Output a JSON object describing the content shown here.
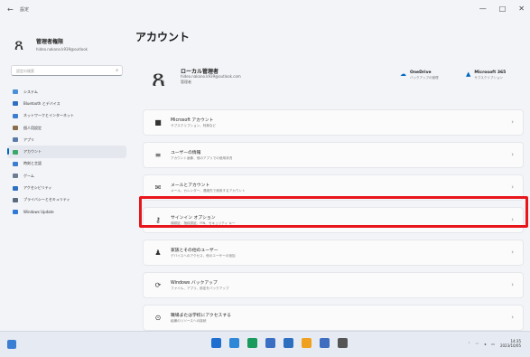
{
  "window": {
    "back_glyph": "←",
    "app_title": "設定",
    "controls": [
      "—",
      "□",
      "✕"
    ]
  },
  "sidebar": {
    "profile": {
      "name": "管理者権限",
      "email": "hideo.nakano.k939@outlook"
    },
    "search_placeholder": "設定の検索",
    "items": [
      {
        "label": "システム",
        "color": "#4a8fd8",
        "active": false
      },
      {
        "label": "Bluetooth とデバイス",
        "color": "#2f6fc0",
        "active": false
      },
      {
        "label": "ネットワークとインターネット",
        "color": "#3c7dd0",
        "active": false
      },
      {
        "label": "個人用設定",
        "color": "#8a6d4a",
        "active": false
      },
      {
        "label": "アプリ",
        "color": "#5a7aa8",
        "active": false
      },
      {
        "label": "アカウント",
        "color": "#39a86a",
        "active": true
      },
      {
        "label": "時刻と言語",
        "color": "#3c7dd0",
        "active": false
      },
      {
        "label": "ゲーム",
        "color": "#6b7d94",
        "active": false
      },
      {
        "label": "アクセシビリティ",
        "color": "#2f6fc0",
        "active": false
      },
      {
        "label": "プライバシーとセキュリティ",
        "color": "#5a6a80",
        "active": false
      },
      {
        "label": "Windows Update",
        "color": "#2f7ad6",
        "active": false
      }
    ]
  },
  "main": {
    "title": "アカウント",
    "account": {
      "name": "ローカル管理者",
      "email": "hideo.nakano.k939@outlook.com",
      "type": "管理者"
    },
    "services": [
      {
        "title": "OneDrive",
        "sub": "バックアップの管理"
      },
      {
        "title": "Microsoft 365",
        "sub": "サブスクリプション"
      }
    ],
    "rows": [
      {
        "title": "Microsoft アカウント",
        "sub": "サブスクリプション、特典など",
        "icon": "■"
      },
      {
        "title": "ユーザーの情報",
        "sub": "アカウント画像、他のアプリでの使用状況",
        "icon": "≡"
      },
      {
        "title": "メールとアカウント",
        "sub": "メール、カレンダー、連絡先で使用するアカウント",
        "icon": "✉"
      },
      {
        "title": "サインイン オプション",
        "sub": "顔認証、指紋認証、PIN、セキュリティ キー",
        "icon": "⚷"
      },
      {
        "title": "家族とその他のユーザー",
        "sub": "デバイスへのアクセス、他のユーザーの追加",
        "icon": "♟"
      },
      {
        "title": "Windows バックアップ",
        "sub": "ファイル、アプリ、設定をバックアップ",
        "icon": "⟳"
      },
      {
        "title": "職場または学校にアクセスする",
        "sub": "組織のリソースへの接続",
        "icon": "⊙"
      }
    ],
    "chevron": "›"
  },
  "taskbar": {
    "icons": [
      "#1f6fd1",
      "#2f87d8",
      "#1a9a5c",
      "#3b6fc4",
      "#2f6fc0",
      "#f0a020",
      "#3f6ec0",
      "#555555"
    ],
    "time": "14:35",
    "date": "2023/10/05"
  }
}
